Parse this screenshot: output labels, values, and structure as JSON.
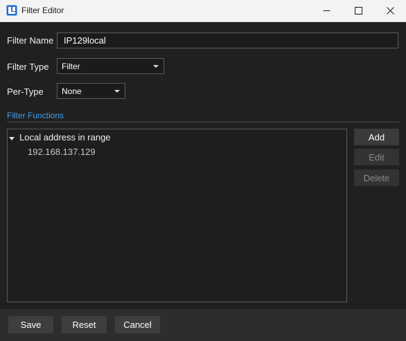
{
  "window": {
    "title": "Filter Editor",
    "icon": "app-logo-icon",
    "controls": [
      "minimize-icon",
      "maximize-icon",
      "close-icon"
    ]
  },
  "form": {
    "filter_name_label": "Filter Name",
    "filter_name_value": "IP129local",
    "filter_type_label": "Filter Type",
    "filter_type_value": "Filter",
    "per_type_label": "Per-Type",
    "per_type_value": "None"
  },
  "functions": {
    "section_title": "Filter Functions",
    "tree": [
      {
        "label": "Local address in range",
        "expanded": true,
        "children": [
          "192.168.137.129"
        ]
      }
    ],
    "buttons": {
      "add": "Add",
      "edit": "Edit",
      "delete": "Delete"
    }
  },
  "footer": {
    "save": "Save",
    "reset": "Reset",
    "cancel": "Cancel"
  },
  "colors": {
    "accent": "#3ea0f0",
    "background": "#202020",
    "titlebar": "#f3f3f3",
    "app_icon": "#1e6fd9"
  }
}
